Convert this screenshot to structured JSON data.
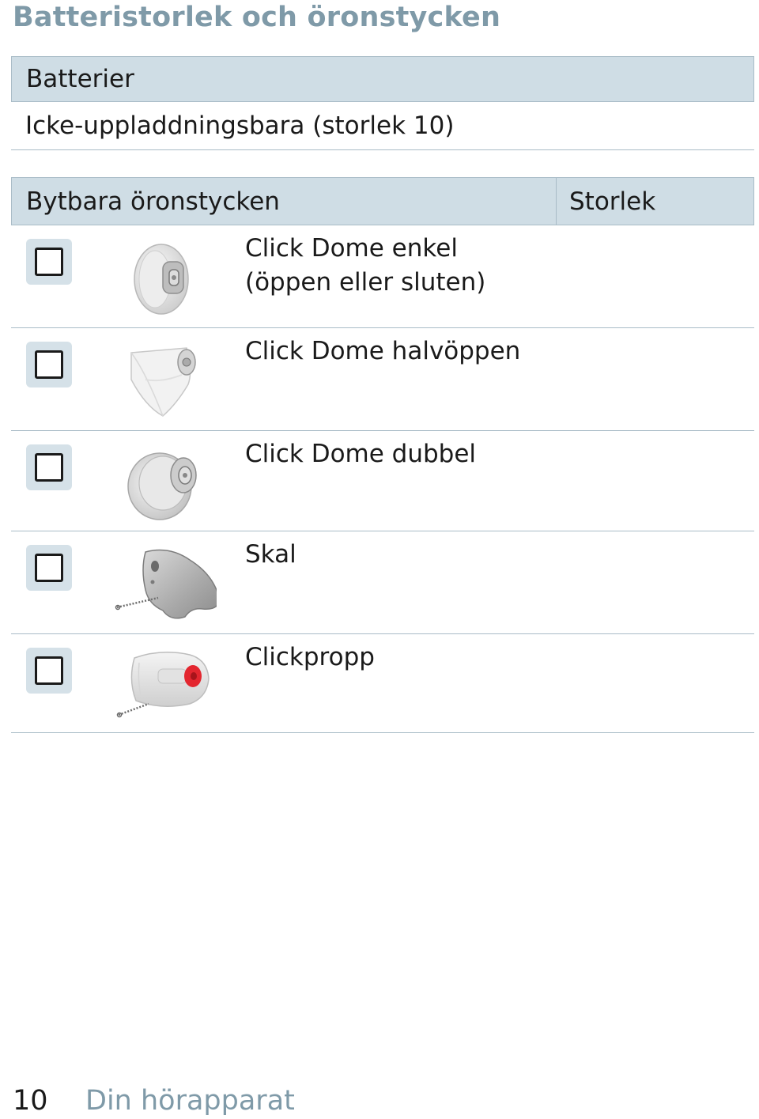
{
  "page": {
    "title": "Batteristorlek och öronstycken"
  },
  "battery": {
    "header": "Batterier",
    "value": "Icke-uppladdningsbara (storlek 10)"
  },
  "earpieces": {
    "header_main": "Bytbara öronstycken",
    "header_size": "Storlek",
    "rows": [
      {
        "label_line1": "Click Dome enkel",
        "label_line2": "(öppen eller sluten)",
        "icon": "click-dome-single-icon"
      },
      {
        "label_line1": "Click Dome halvöppen",
        "icon": "click-dome-semi-open-icon"
      },
      {
        "label_line1": "Click Dome dubbel",
        "icon": "click-dome-double-icon"
      },
      {
        "label_line1": "Skal",
        "icon": "shell-icon"
      },
      {
        "label_line1": "Clickpropp",
        "icon": "click-plug-icon"
      }
    ]
  },
  "footer": {
    "page_number": "10",
    "section": "Din hörapparat"
  },
  "colors": {
    "accent": "#7f9aa8",
    "header_bg": "#cfdde5",
    "rule": "#a9bcc7",
    "plug_red": "#e3262f"
  }
}
